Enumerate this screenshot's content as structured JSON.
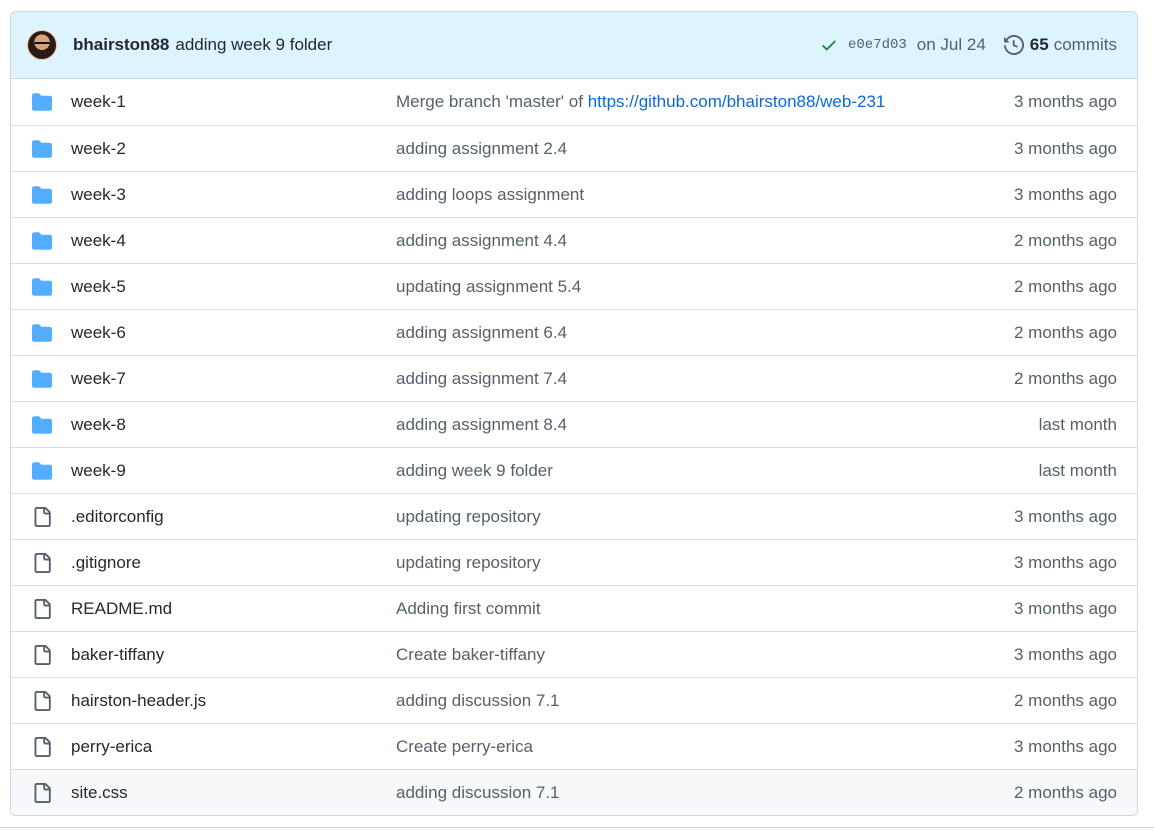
{
  "commit": {
    "author": "bhairston88",
    "message": "adding week 9 folder",
    "status_icon": "check-icon",
    "sha": "e0e7d03",
    "date": "on Jul 24",
    "history_icon": "history-icon",
    "commits_count": "65",
    "commits_label": "commits"
  },
  "colors": {
    "folder": "#54aeff",
    "file": "#57606a",
    "check": "#1a7f37",
    "link": "#0969da",
    "header_bg": "#ddf4ff"
  },
  "files": [
    {
      "type": "folder",
      "name": "week-1",
      "message": "Merge branch 'master' of ",
      "link": "https://github.com/bhairston88/web-231",
      "age": "3 months ago"
    },
    {
      "type": "folder",
      "name": "week-2",
      "message": "adding assignment 2.4",
      "age": "3 months ago"
    },
    {
      "type": "folder",
      "name": "week-3",
      "message": "adding loops assignment",
      "age": "3 months ago"
    },
    {
      "type": "folder",
      "name": "week-4",
      "message": "adding assignment 4.4",
      "age": "2 months ago"
    },
    {
      "type": "folder",
      "name": "week-5",
      "message": "updating assignment 5.4",
      "age": "2 months ago"
    },
    {
      "type": "folder",
      "name": "week-6",
      "message": "adding assignment 6.4",
      "age": "2 months ago"
    },
    {
      "type": "folder",
      "name": "week-7",
      "message": "adding assignment 7.4",
      "age": "2 months ago"
    },
    {
      "type": "folder",
      "name": "week-8",
      "message": "adding assignment 8.4",
      "age": "last month"
    },
    {
      "type": "folder",
      "name": "week-9",
      "message": "adding week 9 folder",
      "age": "last month"
    },
    {
      "type": "file",
      "name": ".editorconfig",
      "message": "updating repository",
      "age": "3 months ago"
    },
    {
      "type": "file",
      "name": ".gitignore",
      "message": "updating repository",
      "age": "3 months ago"
    },
    {
      "type": "file",
      "name": "README.md",
      "message": "Adding first commit",
      "age": "3 months ago"
    },
    {
      "type": "file",
      "name": "baker-tiffany",
      "message": "Create baker-tiffany",
      "age": "3 months ago"
    },
    {
      "type": "file",
      "name": "hairston-header.js",
      "message": "adding discussion 7.1",
      "age": "2 months ago"
    },
    {
      "type": "file",
      "name": "perry-erica",
      "message": "Create perry-erica",
      "age": "3 months ago"
    },
    {
      "type": "file",
      "name": "site.css",
      "message": "adding discussion 7.1",
      "age": "2 months ago"
    }
  ]
}
